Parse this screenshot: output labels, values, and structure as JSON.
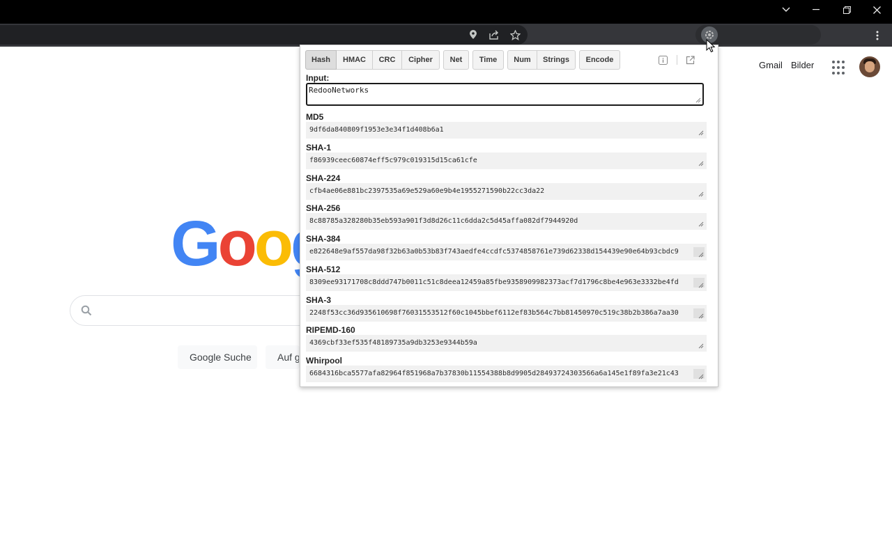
{
  "google": {
    "gmail_link": "Gmail",
    "images_link": "Bilder",
    "logo_letters": [
      "G",
      "o",
      "o",
      "g"
    ],
    "logo_colors": [
      "#4285f4",
      "#ea4335",
      "#fbbc05",
      "#4285f4"
    ],
    "search_button": "Google Suche",
    "lucky_button": "Auf gu"
  },
  "popup": {
    "tabs": [
      {
        "label": "Hash",
        "active": true
      },
      {
        "label": "HMAC"
      },
      {
        "label": "CRC"
      },
      {
        "label": "Cipher"
      },
      {
        "label": "Net"
      },
      {
        "label": "Time"
      },
      {
        "label": "Num"
      },
      {
        "label": "Strings"
      },
      {
        "label": "Encode"
      }
    ],
    "input_label": "Input:",
    "input_value": "RedooNetworks",
    "hashes": [
      {
        "label": "MD5",
        "value": "9df6da840809f1953e3e34f1d408b6a1"
      },
      {
        "label": "SHA-1",
        "value": "f86939ceec60874eff5c979c019315d15ca61cfe"
      },
      {
        "label": "SHA-224",
        "value": "cfb4ae06e881bc2397535a69e529a60e9b4e1955271590b22cc3da22"
      },
      {
        "label": "SHA-256",
        "value": "8c88785a328280b35eb593a901f3d8d26c11c6dda2c5d45affa082df7944920d"
      },
      {
        "label": "SHA-384",
        "value": "e822648e9af557da98f32b63a0b53b83f743aedfe4ccdfc5374858761e739d62338d154439e90e64b93cbdc9"
      },
      {
        "label": "SHA-512",
        "value": "8309ee93171708c8ddd747b0011c51c8deea12459a85fbe9358909982373acf7d1796c8be4e963e3332be4fd"
      },
      {
        "label": "SHA-3",
        "value": "2248f53cc36d935610698f76031553512f60c1045bbef6112ef83b564c7bb81450970c519c38b2b386a7aa30"
      },
      {
        "label": "RIPEMD-160",
        "value": "4369cbf33ef535f48189735a9db3253e9344b59a"
      },
      {
        "label": "Whirpool",
        "value": "6684316bca5577afa82964f851968a7b37830b11554388b8d9905d28493724303566a6a145e1f89fa3e21c43"
      }
    ]
  }
}
